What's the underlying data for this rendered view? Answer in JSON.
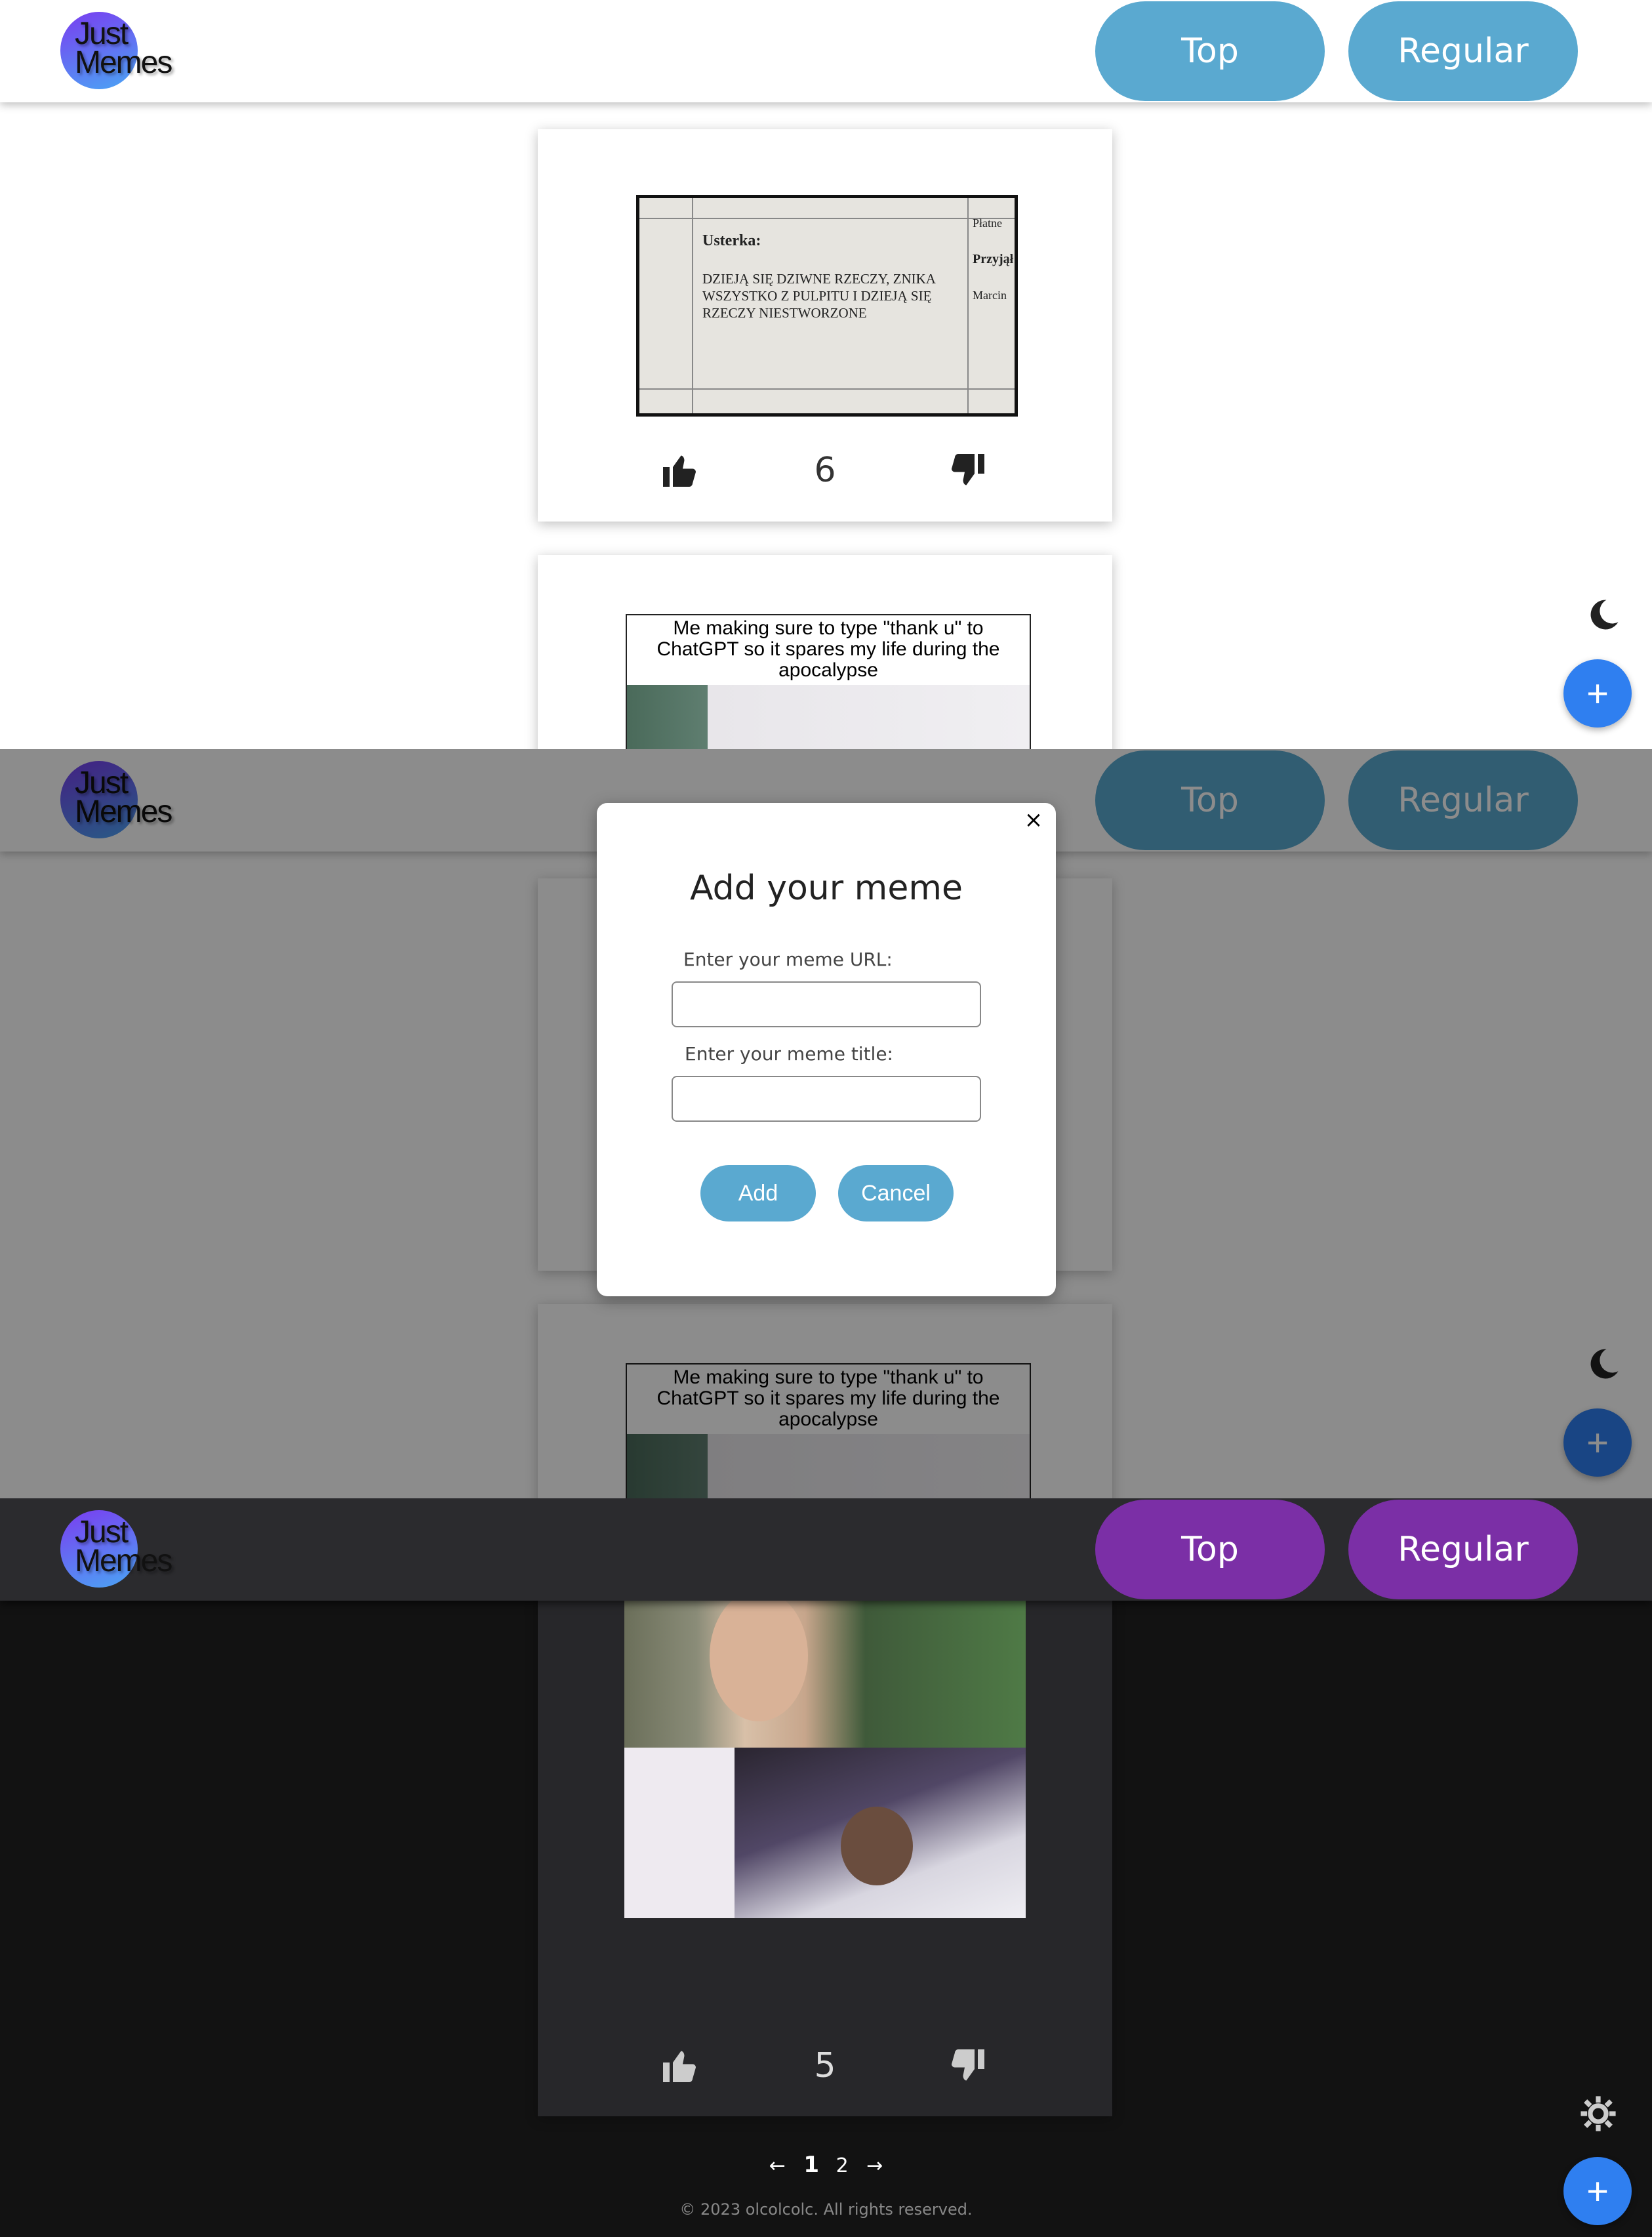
{
  "header": {
    "logo_line1": "Just",
    "logo_line2": "Memes",
    "nav_top": "Top",
    "nav_regular": "Regular"
  },
  "posts": [
    {
      "image_text": {
        "label_usterka": "Usterka:",
        "body": "DZIEJĄ SIĘ DZIWNE RZECZY, ZNIKA WSZYSTKO Z PULPITU I DZIEJĄ SIĘ RZECZY NIESTWORZONE",
        "col_platne": "Płatne",
        "col_przyjal": "Przyjął",
        "col_marcin": "Marcin"
      },
      "votes": "6"
    },
    {
      "caption": "Me making sure to type \"thank u\" to ChatGPT so it spares my life during the apocalypse"
    },
    {
      "votes": "5"
    }
  ],
  "modal": {
    "close": "×",
    "title": "Add your meme",
    "url_label": "Enter your meme URL:",
    "url_value": "",
    "title_label": "Enter your meme title:",
    "title_value": "",
    "add_button": "Add",
    "cancel_button": "Cancel"
  },
  "fab_label": "+",
  "pagination": {
    "prev": "←",
    "pages": [
      "1",
      "2"
    ],
    "current": "1",
    "next": "→"
  },
  "footer": "© 2023 olcolcolc. All rights reserved.",
  "colors": {
    "light_nav": "#5aa9d0",
    "dark_nav": "#7b2fa6",
    "fab": "#2f7ff0",
    "dark_bg": "#121212",
    "dark_header": "#2b2b2e"
  },
  "icons": [
    "thumbs-up-icon",
    "thumbs-down-icon",
    "moon-icon",
    "sun-gear-icon",
    "plus-icon",
    "close-icon",
    "arrow-left-icon",
    "arrow-right-icon"
  ]
}
